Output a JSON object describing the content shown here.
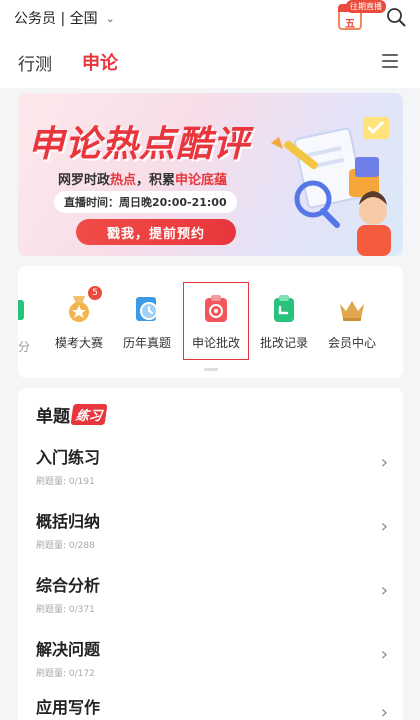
{
  "header": {
    "region_label": "公务员 | 全国",
    "calendar_day": "五",
    "calendar_badge": "往期直播"
  },
  "tabs": [
    {
      "label": "行测",
      "active": false
    },
    {
      "label": "申论",
      "active": true
    }
  ],
  "banner": {
    "title": "申论热点酷评",
    "subtitle_pre": "网罗时政",
    "subtitle_hl1": "热点",
    "subtitle_mid": "，积累",
    "subtitle_hl2": "申论底蕴",
    "time": "直播时间：周日晚20:00-21:00",
    "button": "戳我，提前预约"
  },
  "entries": [
    {
      "label": "分",
      "icon": "partial-green-icon"
    },
    {
      "label": "模考大赛",
      "icon": "medal-icon",
      "badge": "5"
    },
    {
      "label": "历年真题",
      "icon": "history-papers-icon"
    },
    {
      "label": "申论批改",
      "icon": "grading-icon",
      "highlighted": true
    },
    {
      "label": "批改记录",
      "icon": "grading-record-icon"
    },
    {
      "label": "会员中心",
      "icon": "crown-icon"
    }
  ],
  "practice": {
    "title": "单题",
    "tag": "练习",
    "rows": [
      {
        "title": "入门练习",
        "sub": "刷题量: 0/191"
      },
      {
        "title": "概括归纳",
        "sub": "刷题量: 0/288"
      },
      {
        "title": "综合分析",
        "sub": "刷题量: 0/371"
      },
      {
        "title": "解决问题",
        "sub": "刷题量: 0/172"
      },
      {
        "title": "应用写作",
        "sub": ""
      }
    ]
  },
  "colors": {
    "accent": "#e8363c",
    "badge": "#e94b3c",
    "green": "#27c27c",
    "blue": "#3b9be6"
  }
}
